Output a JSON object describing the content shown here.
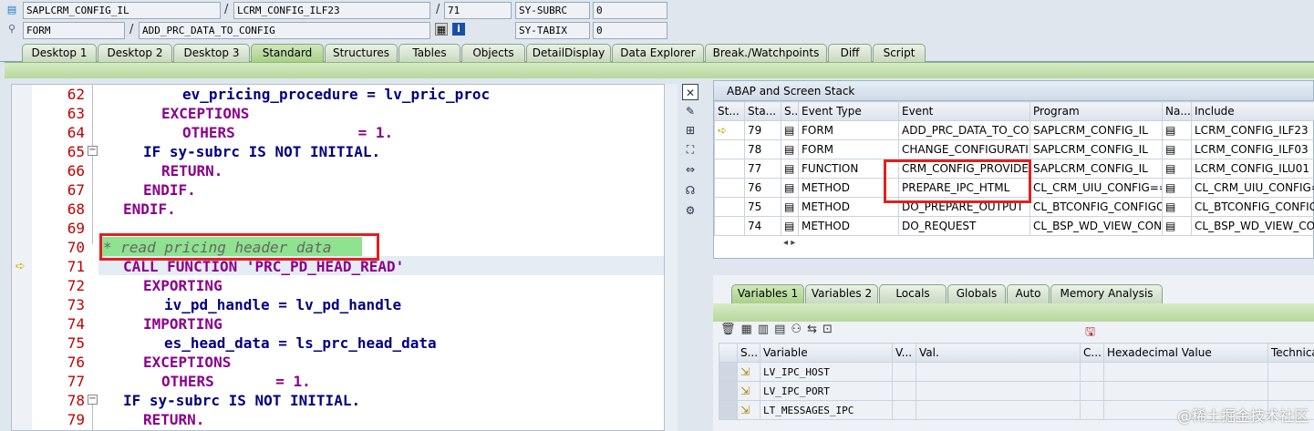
{
  "header": {
    "program": "SAPLCRM_CONFIG_IL",
    "include": "LCRM_CONFIG_ILF23",
    "line": "71",
    "subrc_label": "SY-SUBRC",
    "subrc_value": "0",
    "event_type": "FORM",
    "event": "ADD_PRC_DATA_TO_CONFIG",
    "tabix_label": "SY-TABIX",
    "tabix_value": "0"
  },
  "tabs": [
    "Desktop 1",
    "Desktop 2",
    "Desktop 3",
    "Standard",
    "Structures",
    "Tables",
    "Objects",
    "DetailDisplay",
    "Data Explorer",
    "Break./Watchpoints",
    "Diff",
    "Script"
  ],
  "code_lines": [
    {
      "n": "62",
      "t": "ev_pricing_procedure = lv_pric_proc"
    },
    {
      "n": "63",
      "t": "EXCEPTIONS"
    },
    {
      "n": "64",
      "t": "OTHERS              = 1."
    },
    {
      "n": "65",
      "t": "IF sy-subrc IS NOT INITIAL."
    },
    {
      "n": "66",
      "t": "RETURN."
    },
    {
      "n": "67",
      "t": "ENDIF."
    },
    {
      "n": "68",
      "t": "ENDIF."
    },
    {
      "n": "69",
      "t": ""
    },
    {
      "n": "70",
      "t": "* read pricing header data"
    },
    {
      "n": "71",
      "t": "CALL FUNCTION 'PRC_PD_HEAD_READ'"
    },
    {
      "n": "72",
      "t": "EXPORTING"
    },
    {
      "n": "73",
      "t": "iv_pd_handle = lv_pd_handle"
    },
    {
      "n": "74",
      "t": "IMPORTING"
    },
    {
      "n": "75",
      "t": "es_head_data = ls_prc_head_data"
    },
    {
      "n": "76",
      "t": "EXCEPTIONS"
    },
    {
      "n": "77",
      "t": "OTHERS       = 1."
    },
    {
      "n": "78",
      "t": "IF sy-subrc IS NOT INITIAL."
    },
    {
      "n": "79",
      "t": "RETURN."
    }
  ],
  "stack": {
    "title": "ABAP and Screen Stack",
    "columns": [
      "St...",
      "Sta...",
      "S...",
      "Event Type",
      "Event",
      "Program",
      "Na...",
      "Include"
    ],
    "rows": [
      {
        "level": "79",
        "type": "FORM",
        "event": "ADD_PRC_DATA_TO_CO...",
        "program": "SAPLCRM_CONFIG_IL",
        "include": "LCRM_CONFIG_ILF23"
      },
      {
        "level": "78",
        "type": "FORM",
        "event": "CHANGE_CONFIGURATI...",
        "program": "SAPLCRM_CONFIG_IL",
        "include": "LCRM_CONFIG_ILF03"
      },
      {
        "level": "77",
        "type": "FUNCTION",
        "event": "CRM_CONFIG_PROVIDE_...",
        "program": "SAPLCRM_CONFIG_IL",
        "include": "LCRM_CONFIG_ILU01"
      },
      {
        "level": "76",
        "type": "METHOD",
        "event": "PREPARE_IPC_HTML",
        "program": "CL_CRM_UIU_CONFIG==...",
        "include": "CL_CRM_UIU_CONFIG==..."
      },
      {
        "level": "75",
        "type": "METHOD",
        "event": "DO_PREPARE_OUTPUT",
        "program": "CL_BTCONFIG_CONFIGO...",
        "include": "CL_BTCONFIG_CONFIGO..."
      },
      {
        "level": "74",
        "type": "METHOD",
        "event": "DO_REQUEST",
        "program": "CL_BSP_WD_VIEW_CON...",
        "include": "CL_BSP_WD_VIEW_CON..."
      }
    ]
  },
  "var_tabs": [
    "Variables 1",
    "Variables 2",
    "Locals",
    "Globals",
    "Auto",
    "Memory Analysis"
  ],
  "variables": {
    "columns": [
      "S...",
      "Variable",
      "V...",
      "Val.",
      "C...",
      "Hexadecimal Value",
      "Technica"
    ],
    "rows": [
      "LV_IPC_HOST",
      "LV_IPC_PORT",
      "LT_MESSAGES_IPC"
    ]
  },
  "watermark": "@稀土掘金技术社区"
}
